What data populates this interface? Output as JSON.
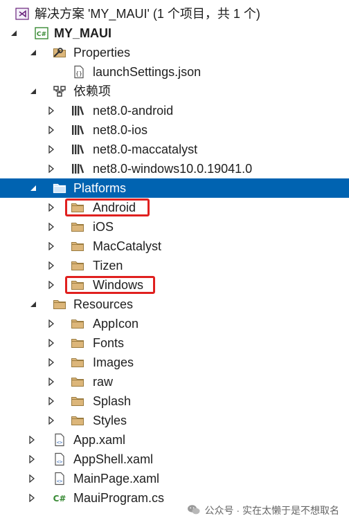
{
  "solution": {
    "title": "解决方案 'MY_MAUI' (1 个项目，共 1 个)"
  },
  "project": {
    "name": "MY_MAUI"
  },
  "properties": {
    "label": "Properties",
    "launch_settings": "launchSettings.json"
  },
  "dependencies": {
    "label": "依赖项",
    "frameworks": [
      "net8.0-android",
      "net8.0-ios",
      "net8.0-maccatalyst",
      "net8.0-windows10.0.19041.0"
    ]
  },
  "platforms": {
    "label": "Platforms",
    "folders": [
      "Android",
      "iOS",
      "MacCatalyst",
      "Tizen",
      "Windows"
    ]
  },
  "resources": {
    "label": "Resources",
    "folders": [
      "AppIcon",
      "Fonts",
      "Images",
      "raw",
      "Splash",
      "Styles"
    ]
  },
  "files": [
    "App.xaml",
    "AppShell.xaml",
    "MainPage.xaml",
    "MauiProgram.cs"
  ],
  "watermark": {
    "text": "公众号 · 实在太懒于是不想取名"
  },
  "colors": {
    "selection": "#0063b1",
    "highlight": "#e0201f",
    "folder": "#dcb67a"
  }
}
